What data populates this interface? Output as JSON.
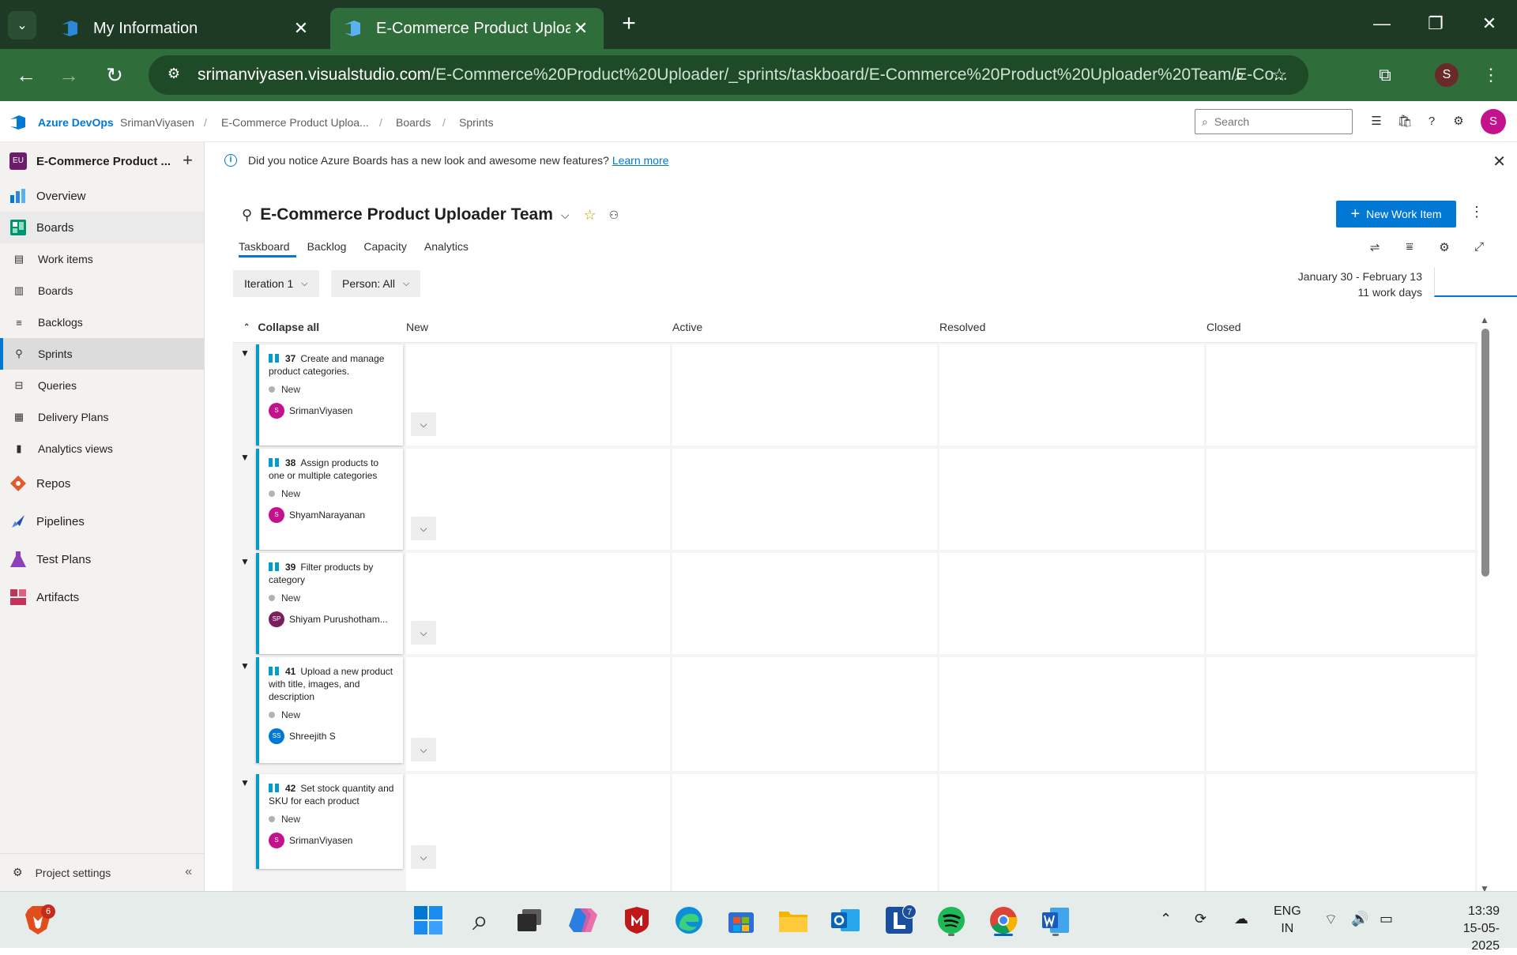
{
  "browser": {
    "tabs": [
      {
        "title": "My Information"
      },
      {
        "title": "E-Commerce Product Uploader"
      }
    ],
    "url_host": "srimanviyasen.visualstudio.com",
    "url_path": "/E-Commerce%20Product%20Uploader/_sprints/taskboard/E-Commerce%20Product%20Uploader%20Team/E-Co...",
    "profile_initial": "S"
  },
  "ado_header": {
    "brand": "Azure DevOps",
    "breadcrumbs": [
      "SrimanViyasen",
      "E-Commerce Product Uploa...",
      "Boards",
      "Sprints"
    ],
    "search_placeholder": "Search",
    "avatar_initial": "S"
  },
  "sidebar": {
    "project_badge": "EU",
    "project_name": "E-Commerce Product ...",
    "items": [
      {
        "label": "Overview"
      },
      {
        "label": "Boards"
      },
      {
        "label": "Work items"
      },
      {
        "label": "Boards"
      },
      {
        "label": "Backlogs"
      },
      {
        "label": "Sprints"
      },
      {
        "label": "Queries"
      },
      {
        "label": "Delivery Plans"
      },
      {
        "label": "Analytics views"
      },
      {
        "label": "Repos"
      },
      {
        "label": "Pipelines"
      },
      {
        "label": "Test Plans"
      },
      {
        "label": "Artifacts"
      }
    ],
    "settings_label": "Project settings"
  },
  "banner": {
    "text": "Did you notice Azure Boards has a new look and awesome new features?",
    "link": "Learn more"
  },
  "team": {
    "title": "E-Commerce Product Uploader Team",
    "new_work_item": "New Work Item"
  },
  "pivots": [
    "Taskboard",
    "Backlog",
    "Capacity",
    "Analytics"
  ],
  "filters": {
    "iteration": "Iteration 1",
    "person": "Person: All"
  },
  "sprint": {
    "dates": "January 30 - February 13",
    "work_days": "11 work days"
  },
  "board": {
    "collapse_all": "Collapse all",
    "columns": [
      "New",
      "Active",
      "Resolved",
      "Closed"
    ],
    "items": [
      {
        "id": "37",
        "title": "Create and manage product categories.",
        "state": "New",
        "assignee": "SrimanViyasen",
        "initials": "S",
        "avatar_color": "#c4128d"
      },
      {
        "id": "38",
        "title": "Assign products to one or multiple categories",
        "state": "New",
        "assignee": "ShyamNarayanan",
        "initials": "S",
        "avatar_color": "#c4128d"
      },
      {
        "id": "39",
        "title": "Filter products by category",
        "state": "New",
        "assignee": "Shiyam Purushotham...",
        "initials": "SP",
        "avatar_color": "#7a1e5c"
      },
      {
        "id": "41",
        "title": "Upload a new product with title, images, and description",
        "state": "New",
        "assignee": "Shreejith S",
        "initials": "SS",
        "avatar_color": "#0078d4"
      },
      {
        "id": "42",
        "title": "Set stock quantity and SKU for each product",
        "state": "New",
        "assignee": "SrimanViyasen",
        "initials": "S",
        "avatar_color": "#c4128d"
      }
    ]
  },
  "taskbar": {
    "badge_brave": "6",
    "badge_l": "7",
    "lang_1": "ENG",
    "lang_2": "IN",
    "time": "13:39",
    "date": "15-05-2025"
  },
  "colors": {
    "accent": "#0078d4",
    "chrome_dark": "#1e3a24",
    "chrome_mid": "#2f6e3b",
    "card_border": "#009ccc"
  }
}
